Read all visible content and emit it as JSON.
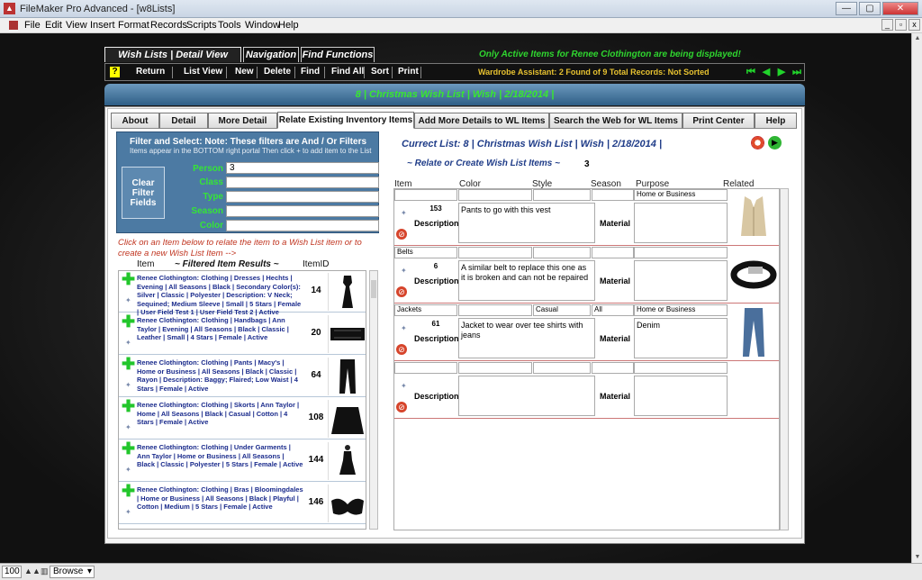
{
  "window": {
    "title": "FileMaker Pro Advanced - [w8Lists]"
  },
  "menus": [
    "File",
    "Edit",
    "View",
    "Insert",
    "Format",
    "Records",
    "Scripts",
    "Tools",
    "Window",
    "Help"
  ],
  "toolbar_tabs": [
    "Wish Lists | Detail View Toolbar",
    "Navigation",
    "Find Functions"
  ],
  "notice": "Only Active Items for Renee Clothington are being displayed!",
  "toolbar": {
    "help": "?",
    "buttons": [
      "Return",
      "List View",
      "New",
      "Delete",
      "Find",
      "Find All",
      "Sort",
      "Print"
    ],
    "assistant": "Wardrobe Assistant:  2 Found of 9 Total Records: Not Sorted"
  },
  "header_title": "8  | Christmas Wish List  | Wish  | 2/18/2014  |",
  "tabs": [
    "About",
    "Detail",
    "More Detail",
    "Relate Existing Inventory Items",
    "Add More Details to WL Items",
    "Search the Web for WL Items",
    "Print Center",
    "Help"
  ],
  "filters": {
    "head": "Filter and Select: Note: These filters are And / Or Filters",
    "sub": "Items  appear in the BOTTOM right portal Then click + to add item to the List",
    "clear_label": "Clear Filter Fields",
    "fields": [
      {
        "label": "Person",
        "value": "3"
      },
      {
        "label": "Class",
        "value": ""
      },
      {
        "label": "Type",
        "value": ""
      },
      {
        "label": "Season",
        "value": ""
      },
      {
        "label": "Color",
        "value": ""
      }
    ]
  },
  "relate_hint": "Click on an Item below to relate the item to a Wish List item or to create a new Wish List Item -->",
  "filtered": {
    "col_item": "Item",
    "col_title": "~ Filtered Item Results ~",
    "col_id": "ItemID",
    "rows": [
      {
        "text": "Renee Clothington: Clothing | Dresses | Hechts | Evening | All Seasons | Black | Secondary Color(s): Silver | Classic | Polyester | Description: V Neck; Sequined; Medium Sleeve | Small | 5 Stars | Female | User Field Test 1  | User Field Test 2  | Active",
        "id": "14"
      },
      {
        "text": "Renee Clothington: Clothing | Handbags | Ann Taylor | Evening | All Seasons | Black | Classic | Leather | Small | 4 Stars | Female | Active",
        "id": "20"
      },
      {
        "text": "Renee Clothington: Clothing | Pants | Macy's | Home or Business | All Seasons | Black | Classic | Rayon | Description: Baggy; Flaired; Low Waist | 4 Stars | Female | Active",
        "id": "64"
      },
      {
        "text": "Renee Clothington: Clothing | Skorts | Ann Taylor | Home | All Seasons | Black | Casual | Cotton | 4 Stars | Female | Active",
        "id": "108"
      },
      {
        "text": "Renee Clothington: Clothing | Under Garments | Ann Taylor | Home or Business | All Seasons | Black | Classic | Polyester | 5 Stars | Female | Active",
        "id": "144"
      },
      {
        "text": "Renee Clothington: Clothing | Bras | Bloomingdales | Home or Business | All Seasons | Black | Playful | Cotton | Medium | 5 Stars | Female | Active",
        "id": "146"
      }
    ]
  },
  "current_list": "Currect List:  8  | Christmas Wish List  | Wish  | 2/18/2014  |",
  "relate_create": "~ Relate or Create Wish List Items  ~",
  "relate_count": "3",
  "portal_cols": [
    "Item",
    "Color",
    "Style",
    "Season",
    "Purpose",
    "Related"
  ],
  "portal_rows": [
    {
      "item": "",
      "color": "",
      "style": "",
      "season": "",
      "purpose": "Home or Business",
      "num": "153",
      "desc": "Pants to go with this vest",
      "material": ""
    },
    {
      "item": "Belts",
      "color": "",
      "style": "",
      "season": "",
      "purpose": "",
      "num": "6",
      "desc": "A similar belt to replace this one as it is broken and can not be repaired",
      "material": ""
    },
    {
      "item": "Jackets",
      "color": "",
      "style": "Casual",
      "season": "All",
      "purpose": "Home or Business",
      "num": "61",
      "desc": "Jacket to wear over tee shirts with jeans",
      "material": "Denim"
    },
    {
      "item": "",
      "color": "",
      "style": "",
      "season": "",
      "purpose": "",
      "num": "",
      "desc": "",
      "material": ""
    }
  ],
  "labels": {
    "description": "Description",
    "material": "Material"
  },
  "status": {
    "zoom": "100",
    "mode": "Browse"
  }
}
